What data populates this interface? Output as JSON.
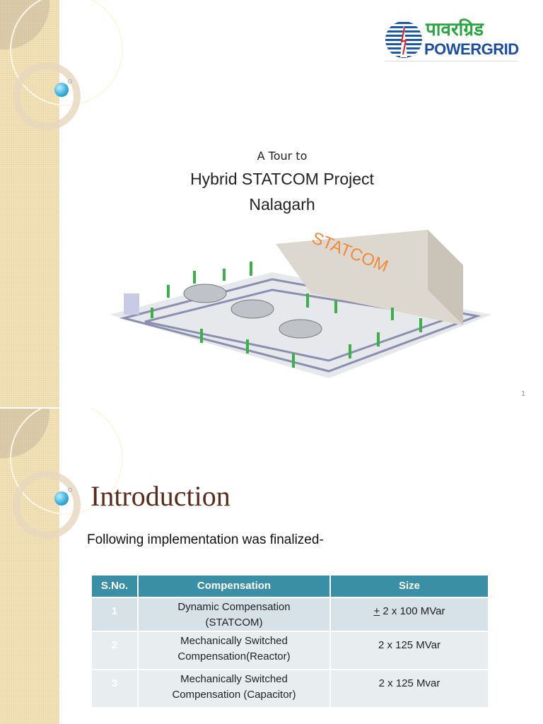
{
  "slide1": {
    "logo": {
      "hindi": "पावरग्रिड",
      "english": "POWERGRID"
    },
    "subtitle": "A Tour to",
    "title_line1": "Hybrid STATCOM Project",
    "title_line2": "Nalagarh",
    "building_label": "STATCOM",
    "page_number": "1"
  },
  "slide2": {
    "title": "Introduction",
    "lead": "Following implementation was finalized-",
    "table": {
      "headers": [
        "S.No.",
        "Compensation",
        "Size"
      ],
      "rows": [
        {
          "sno": "1",
          "comp1": "Dynamic Compensation",
          "comp2": "(STATCOM)",
          "size_prefix": "+",
          "size": " 2 x 100 MVar"
        },
        {
          "sno": "2",
          "comp1": "Mechanically Switched",
          "comp2": "Compensation(Reactor)",
          "size_prefix": "",
          "size": "2 x 125 MVar"
        },
        {
          "sno": "3",
          "comp1": "Mechanically Switched",
          "comp2": "Compensation (Capacitor)",
          "size_prefix": "",
          "size": "2 x 125 Mvar"
        }
      ]
    }
  },
  "colors": {
    "table_header": "#3a8fa7",
    "title": "#5a2a1a",
    "logo_green": "#2aa542",
    "logo_blue": "#1c4fa0"
  }
}
